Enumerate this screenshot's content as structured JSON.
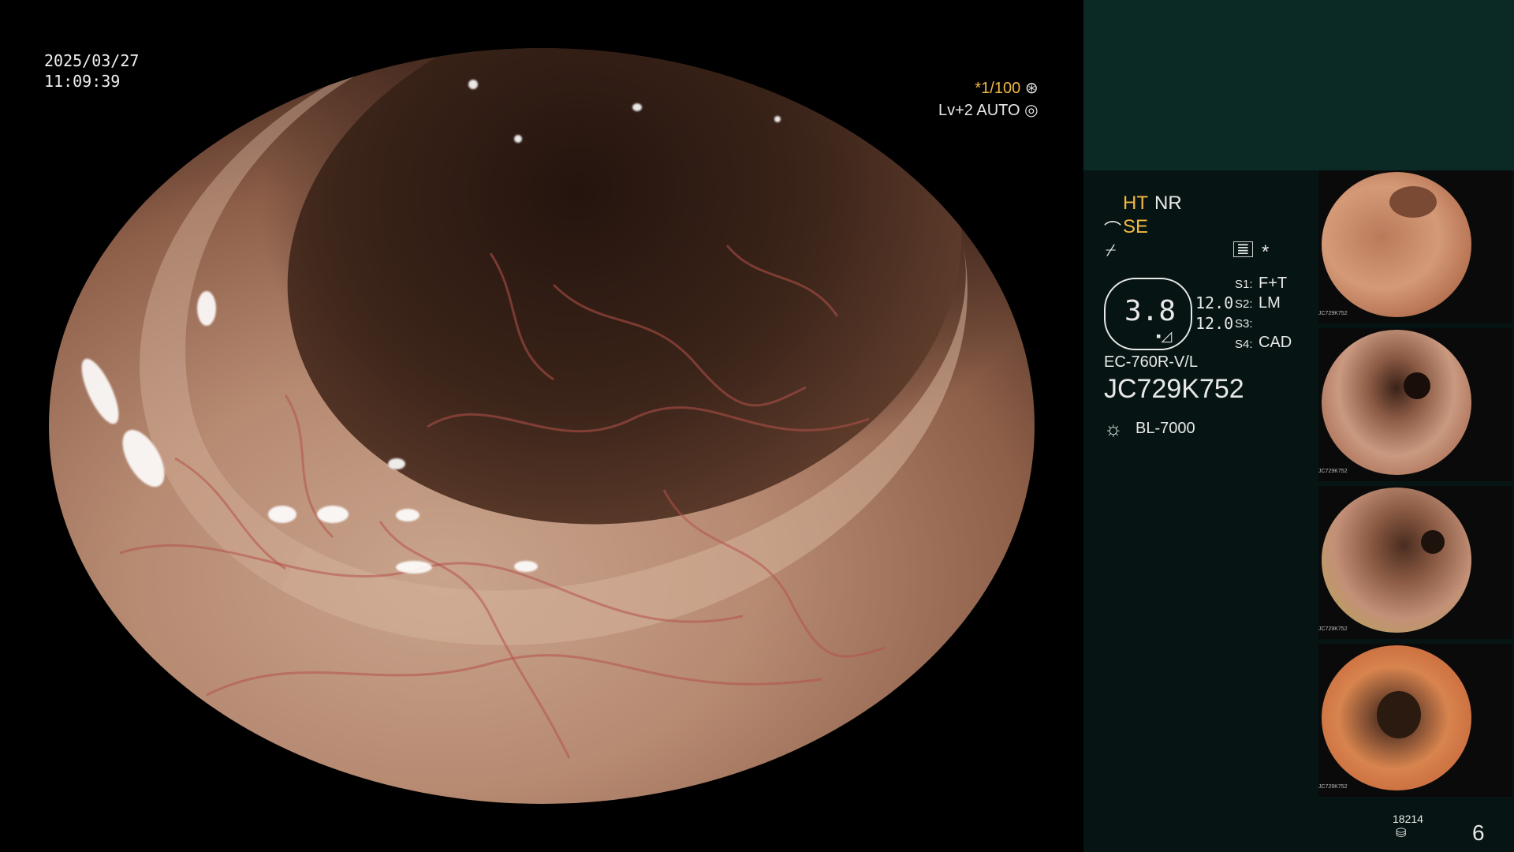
{
  "overlay": {
    "date": "2025/03/27",
    "time": "11:09:39",
    "shutter": "*1/100",
    "level": "Lv+2 AUTO"
  },
  "panel": {
    "ht": "HT",
    "nr": "NR",
    "se": "SE",
    "score": "3.8",
    "value1": "12.0",
    "value2": "12.0",
    "s1_key": "S1:",
    "s1_val": "F+T",
    "s2_key": "S2:",
    "s2_val": "LM",
    "s3_key": "S3:",
    "s3_val": "",
    "s4_key": "S4:",
    "s4_val": "CAD",
    "scope_model": "EC-760R-V/L",
    "serial": "JC729K752",
    "light_source": "BL-7000",
    "counter": "18214",
    "page": "6"
  },
  "thumbnails": [
    {
      "label": "JC729K752"
    },
    {
      "label": "JC729K752"
    },
    {
      "label": "JC729K752"
    },
    {
      "label": "JC729K752"
    }
  ],
  "colors": {
    "accent": "#f2b844",
    "panel_bg": "#061513",
    "panel_top_bg": "#0b2a26"
  }
}
